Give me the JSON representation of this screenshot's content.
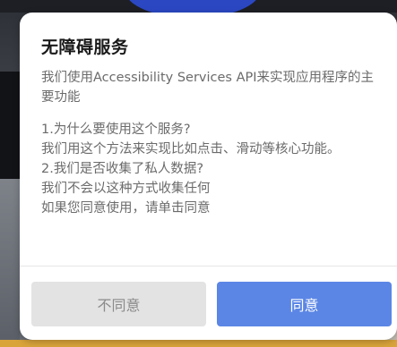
{
  "dialog": {
    "title": "无障碍服务",
    "body": {
      "intro": "我们使用Accessibility Services API来实现应用程序的主要功能",
      "q1": "1.为什么要使用这个服务?",
      "a1": "我们用这个方法来实现比如点击、滑动等核心功能。",
      "q2": "2.我们是否收集了私人数据?",
      "a2": "我们不会以这种方式收集任何",
      "consent": "如果您同意使用，请单击同意"
    },
    "buttons": {
      "disagree": "不同意",
      "agree": "同意"
    }
  },
  "colors": {
    "agree_button": "#5b86e5",
    "disagree_button": "#e3e3e3",
    "title_text": "#1a1a1a",
    "body_text": "#6b6b6b"
  }
}
